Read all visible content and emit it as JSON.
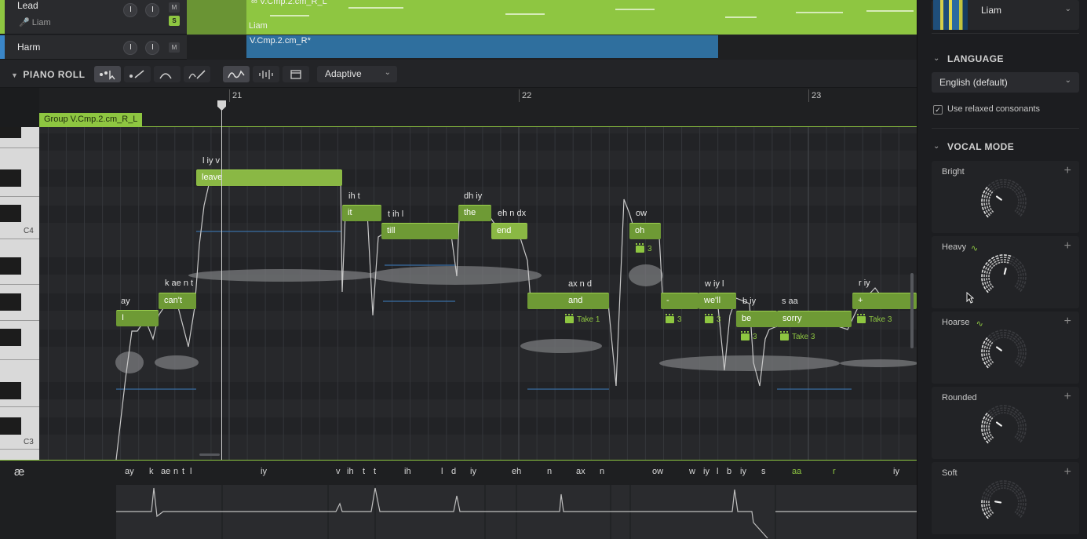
{
  "tracks": [
    {
      "name": "Lead",
      "singer": "Liam",
      "mute": "M",
      "solo": "S",
      "clip_name": "V.Cmp.2.cm_R_L",
      "clip_singer": "Liam"
    },
    {
      "name": "Harm",
      "mute": "M",
      "clip_name": "V.Cmp.2.cm_R*"
    }
  ],
  "piano_roll": {
    "title": "PIANO ROLL",
    "mode": "Adaptive",
    "bars": [
      "21",
      "22",
      "23"
    ],
    "group_label": "Group V.Cmp.2.cm_R_L",
    "keys": {
      "c4": "C4",
      "c3": "C3"
    }
  },
  "notes": [
    {
      "lyric": "I",
      "phon": "ay"
    },
    {
      "lyric": "can't",
      "phon": "k ae n t"
    },
    {
      "lyric": "leave",
      "phon": "l iy v"
    },
    {
      "lyric": "it",
      "phon": "ih t"
    },
    {
      "lyric": "till",
      "phon": "t ih l"
    },
    {
      "lyric": "the",
      "phon": "dh iy"
    },
    {
      "lyric": "end",
      "phon": "eh n dx"
    },
    {
      "lyric": "and",
      "phon": "ax n d"
    },
    {
      "lyric": "oh",
      "phon": "ow"
    },
    {
      "lyric": "-",
      "phon": ""
    },
    {
      "lyric": "we'll",
      "phon": "w iy l"
    },
    {
      "lyric": "be",
      "phon": "b iy"
    },
    {
      "lyric": "sorry",
      "phon": "s aa"
    },
    {
      "lyric": "+",
      "phon": "r iy"
    }
  ],
  "takes": [
    "3",
    "Take 1",
    "3",
    "3",
    "3",
    "Take 3",
    "Take 3"
  ],
  "phoneme_lane": {
    "icon": "æ",
    "phonemes": [
      "ay",
      "k",
      "ae",
      "n",
      "t",
      "l",
      "iy",
      "v",
      "ih",
      "t",
      "t",
      "ih",
      "l",
      "d",
      "iy",
      "eh",
      "n",
      "ax",
      "n",
      "ow",
      "w",
      "iy",
      "l",
      "b",
      "iy",
      "s",
      "aa",
      "r",
      "iy"
    ]
  },
  "panel": {
    "singer": "Liam",
    "language_title": "LANGUAGE",
    "language": "English (default)",
    "relaxed_consonants": "Use relaxed consonants",
    "relaxed_consonants_checked": "✓",
    "vocal_mode_title": "VOCAL MODE",
    "modes": [
      {
        "name": "Bright",
        "level": 0.3,
        "active": false
      },
      {
        "name": "Heavy",
        "level": 0.55,
        "active": true
      },
      {
        "name": "Hoarse",
        "level": 0.3,
        "active": true
      },
      {
        "name": "Rounded",
        "level": 0.3,
        "active": false
      },
      {
        "name": "Soft",
        "level": 0.2,
        "active": false
      }
    ]
  },
  "colors": {
    "accent": "#8ec641",
    "note": "#6e9a35",
    "harm_clip": "#2f6f9e",
    "background": "#27282b"
  }
}
